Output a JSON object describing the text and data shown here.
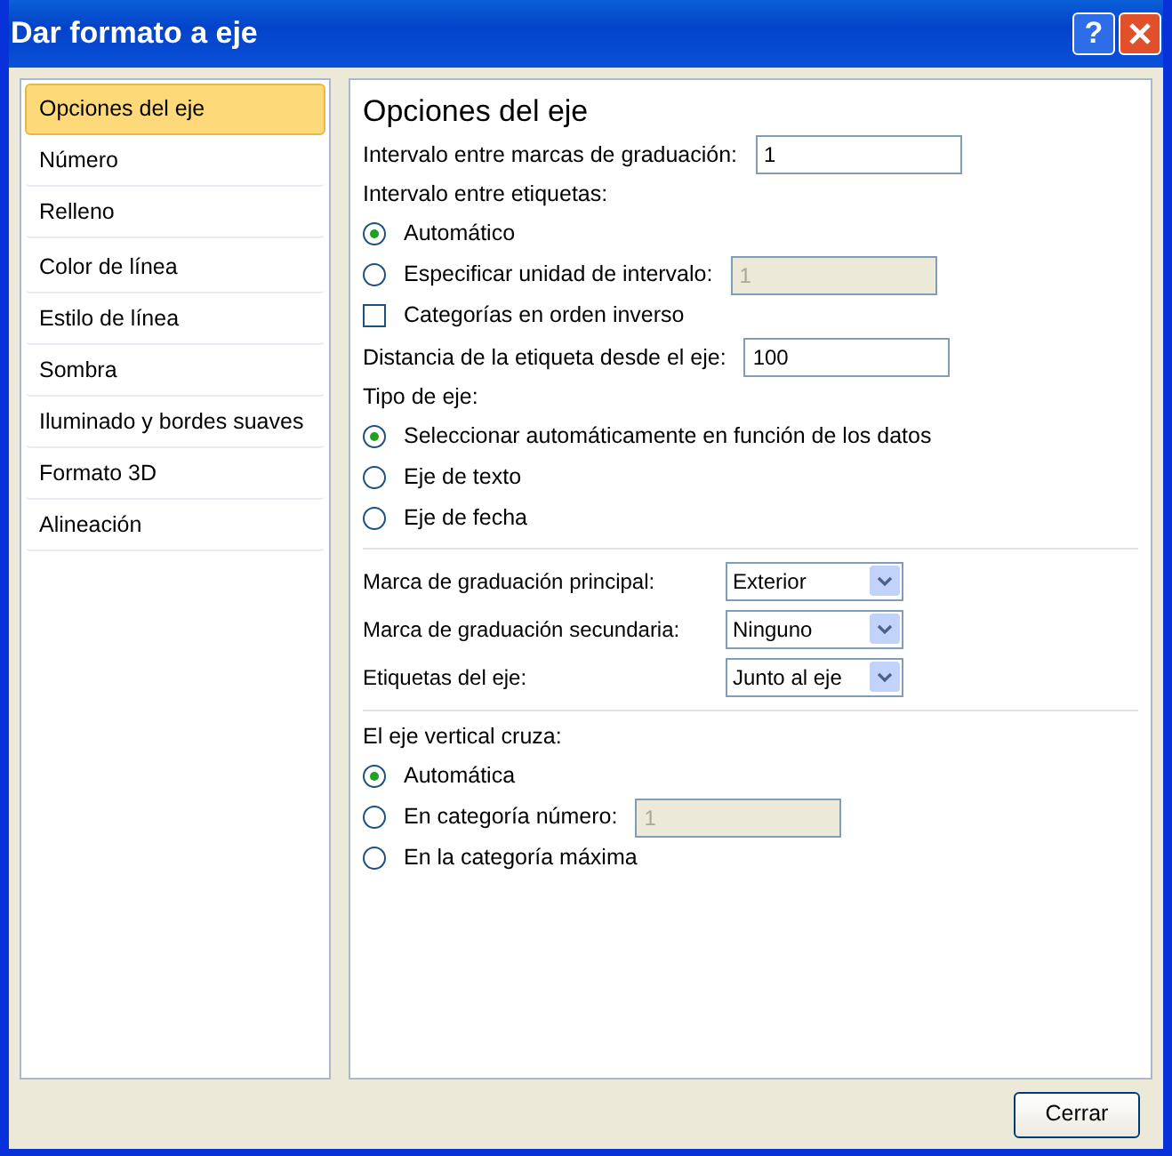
{
  "window": {
    "title": "Dar formato a eje",
    "help_glyph": "?"
  },
  "sidebar": {
    "items": [
      {
        "label": "Opciones del eje",
        "selected": true
      },
      {
        "label": "Número",
        "selected": false
      },
      {
        "label": "Relleno",
        "selected": false
      },
      {
        "label": "Color de línea",
        "selected": false
      },
      {
        "label": "Estilo de línea",
        "selected": false
      },
      {
        "label": "Sombra",
        "selected": false
      },
      {
        "label": "Iluminado y bordes suaves",
        "selected": false
      },
      {
        "label": "Formato 3D",
        "selected": false
      },
      {
        "label": "Alineación",
        "selected": false
      }
    ]
  },
  "content": {
    "heading": "Opciones del eje",
    "rows": [
      {
        "kind": "field",
        "label": "Intervalo entre marcas de graduación:",
        "value": "1",
        "disabled": false
      },
      {
        "kind": "label",
        "label": "Intervalo entre etiquetas:"
      },
      {
        "kind": "radio",
        "label": "Automático",
        "selected": true
      },
      {
        "kind": "radio",
        "label": "Especificar unidad de intervalo:",
        "selected": false,
        "value": "1",
        "disabled": true
      },
      {
        "kind": "checkbox",
        "label": "Categorías en orden inverso",
        "checked": false
      },
      {
        "kind": "field",
        "label": "Distancia de la etiqueta desde el eje:",
        "value": "100",
        "disabled": false
      },
      {
        "kind": "label",
        "label": "Tipo de eje:"
      },
      {
        "kind": "radio",
        "label": "Seleccionar automáticamente en función de los datos",
        "selected": true
      },
      {
        "kind": "radio",
        "label": "Eje de texto",
        "selected": false
      },
      {
        "kind": "radio",
        "label": "Eje de fecha",
        "selected": false
      },
      {
        "kind": "divider"
      },
      {
        "kind": "select",
        "label": "Marca de graduación principal:",
        "value": "Exterior"
      },
      {
        "kind": "select",
        "label": "Marca de graduación secundaria:",
        "value": "Ninguno"
      },
      {
        "kind": "select",
        "label": "Etiquetas del eje:",
        "value": "Junto al eje"
      },
      {
        "kind": "divider"
      },
      {
        "kind": "label",
        "label": "El eje vertical cruza:"
      },
      {
        "kind": "radio",
        "label": "Automática",
        "selected": true
      },
      {
        "kind": "radio",
        "label": "En categoría número:",
        "selected": false,
        "value": "1",
        "disabled": true
      },
      {
        "kind": "radio",
        "label": "En la categoría máxima",
        "selected": false
      }
    ]
  },
  "buttons": [
    "Cerrar"
  ]
}
